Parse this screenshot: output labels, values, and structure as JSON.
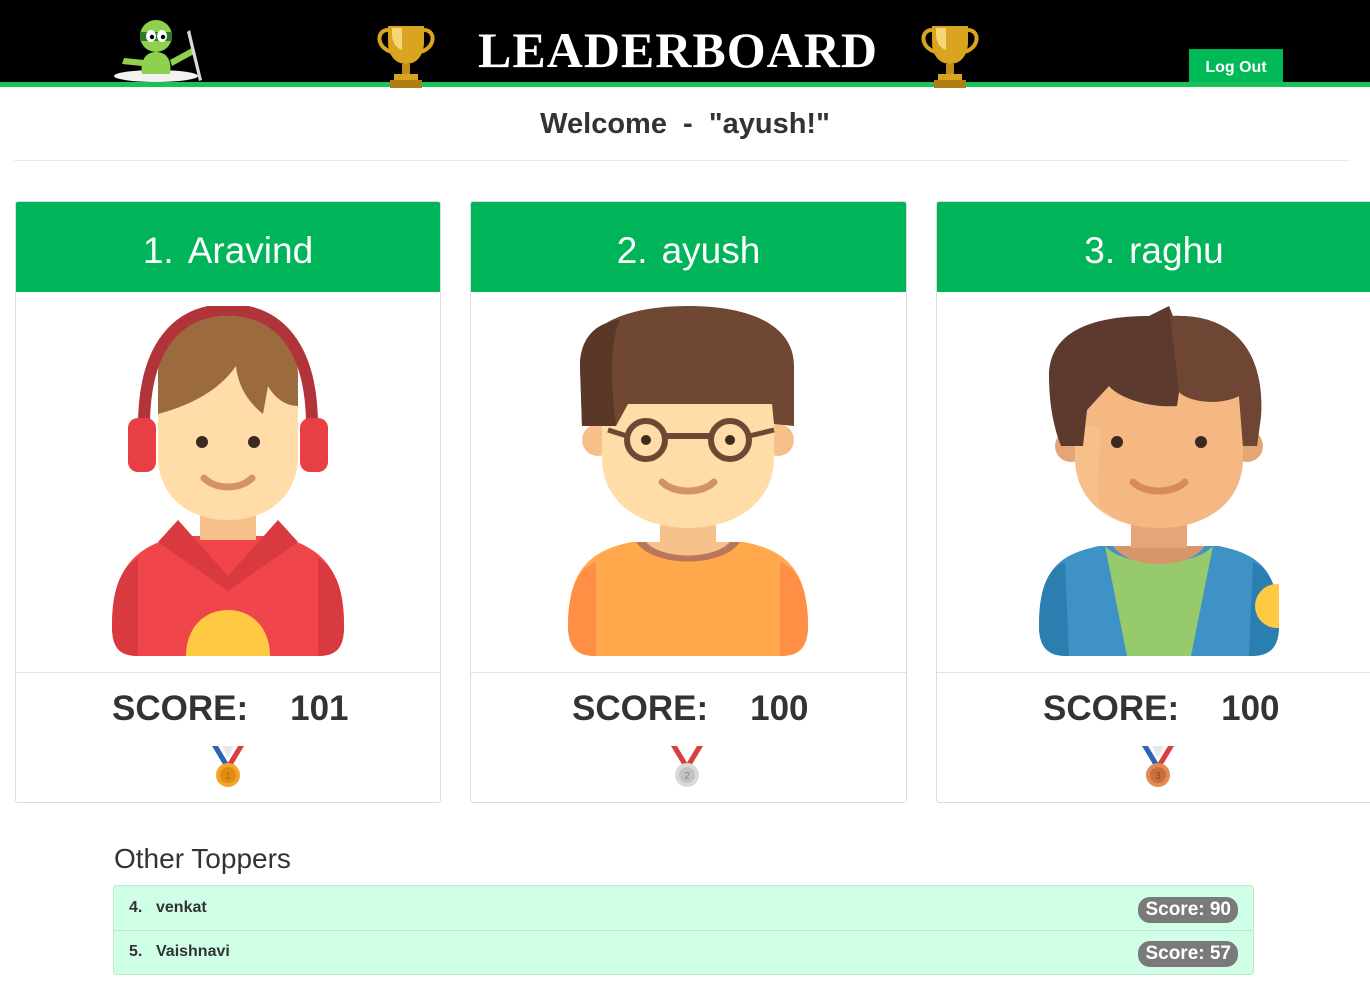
{
  "header": {
    "title": "LEADERBOARD",
    "logout_label": "Log Out",
    "logo_icon": "ninja-mascot-icon",
    "trophy_icon": "gold-trophy-icon",
    "accent_color": "#00b45a",
    "bar_color": "#000000"
  },
  "welcome": {
    "prefix": "Welcome  -  ",
    "user": "\"ayush!\""
  },
  "top_three": [
    {
      "rank": "1.",
      "name": "Aravind",
      "score_label": "SCORE:",
      "score": "101",
      "avatar_icon": "boy-headphones-avatar-icon",
      "medal_icon": "gold-medal-icon",
      "medal_number": "1"
    },
    {
      "rank": "2.",
      "name": "ayush",
      "score_label": "SCORE:",
      "score": "100",
      "avatar_icon": "boy-glasses-avatar-icon",
      "medal_icon": "silver-medal-icon",
      "medal_number": "2"
    },
    {
      "rank": "3.",
      "name": "raghu",
      "score_label": "SCORE:",
      "score": "100",
      "avatar_icon": "boy-jacket-avatar-icon",
      "medal_icon": "bronze-medal-icon",
      "medal_number": "3"
    }
  ],
  "others": {
    "title": "Other Toppers",
    "rows": [
      {
        "rank": "4.",
        "name": "venkat",
        "score": "Score: 90"
      },
      {
        "rank": "5.",
        "name": "Vaishnavi",
        "score": "Score: 57"
      }
    ]
  }
}
